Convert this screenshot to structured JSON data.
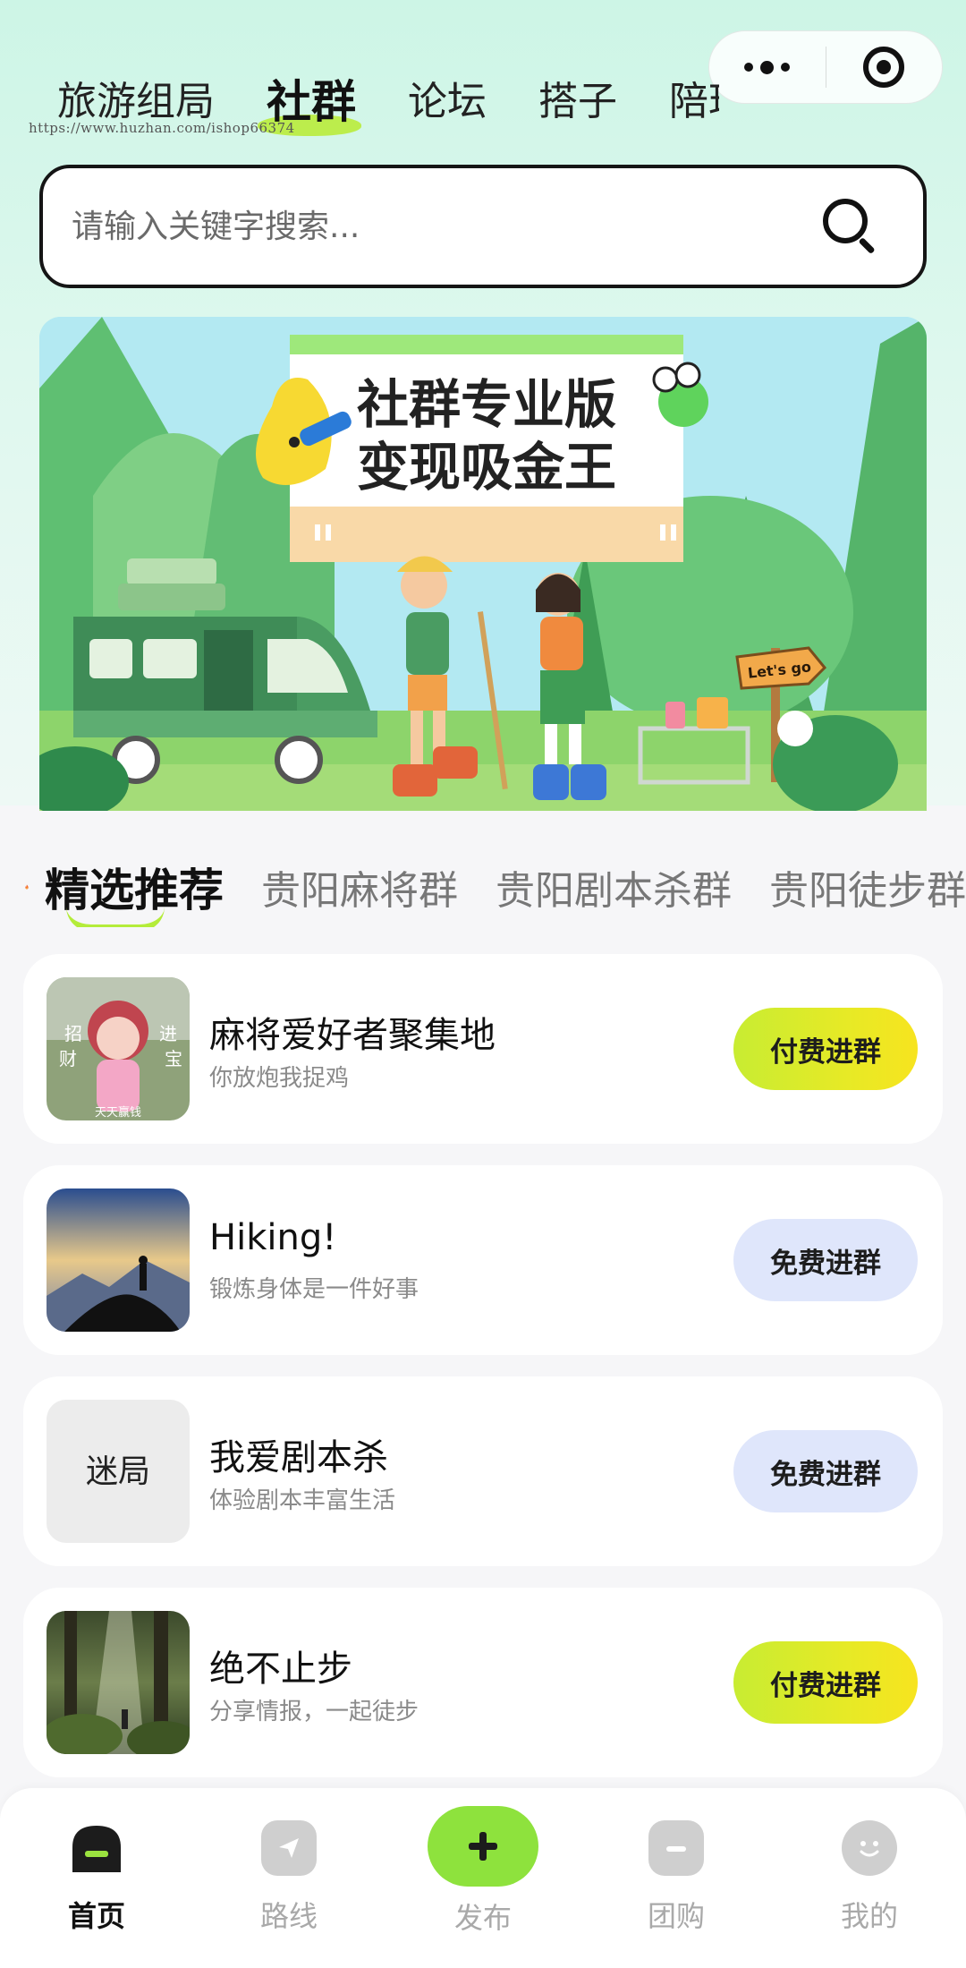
{
  "watermark": "https://www.huzhan.com/ishop66374",
  "top_tabs": [
    "旅游组局",
    "社群",
    "论坛",
    "搭子",
    "陪玩"
  ],
  "search": {
    "placeholder": "请输入关键字搜索..."
  },
  "banner": {
    "line1": "社群专业版",
    "line2": "变现吸金王",
    "sign": "Let's go"
  },
  "category_bar": {
    "title": "精选推荐",
    "items": [
      "贵阳麻将群",
      "贵阳剧本杀群",
      "贵阳徒步群"
    ]
  },
  "groups": [
    {
      "name": "麻将爱好者聚集地",
      "desc": "你放炮我捉鸡",
      "button": "付费进群",
      "type": "paid",
      "thumb_text": [
        "招",
        "财",
        "进",
        "宝",
        "天天赢钱"
      ]
    },
    {
      "name": "Hiking!",
      "desc": "锻炼身体是一件好事",
      "button": "免费进群",
      "type": "free"
    },
    {
      "name": "我爱剧本杀",
      "desc": "体验剧本丰富生活",
      "button": "免费进群",
      "type": "free",
      "thumb_text": [
        "迷局"
      ]
    },
    {
      "name": "绝不止步",
      "desc": "分享情报，一起徒步",
      "button": "付费进群",
      "type": "paid"
    }
  ],
  "bottom_nav": [
    {
      "label": "首页",
      "icon": "home-icon",
      "active": true
    },
    {
      "label": "路线",
      "icon": "route-icon",
      "active": false
    },
    {
      "label": "发布",
      "icon": "plus-icon",
      "active": false
    },
    {
      "label": "团购",
      "icon": "group-buy-icon",
      "active": false
    },
    {
      "label": "我的",
      "icon": "profile-icon",
      "active": false
    }
  ],
  "colors": {
    "accent_green": "#b6ec3c",
    "paid_button": "#e6ea26",
    "free_button": "#dfe6fb",
    "background": "#f6f6f8"
  }
}
